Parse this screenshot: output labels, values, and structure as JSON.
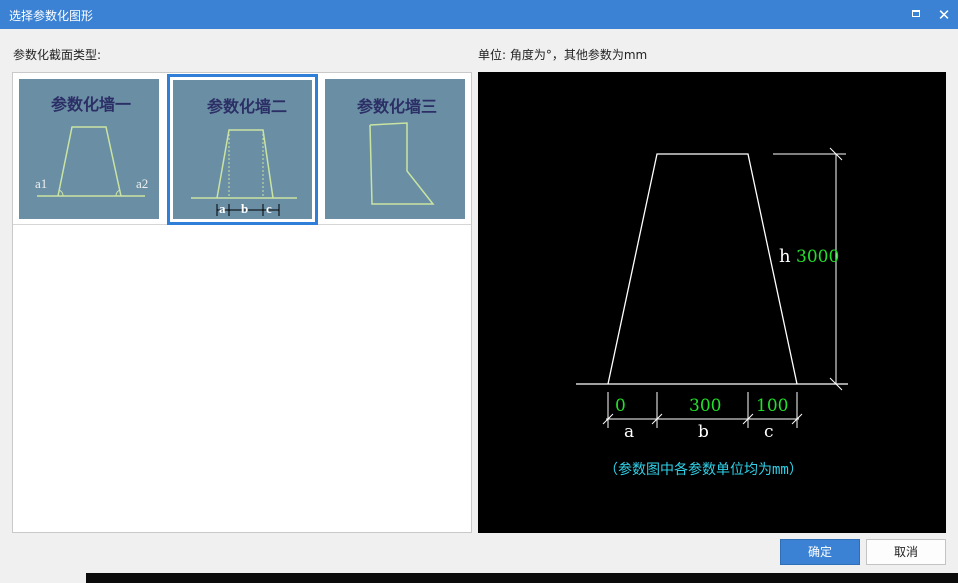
{
  "window": {
    "title": "选择参数化图形",
    "maximize_icon": "maximize-icon",
    "close_icon": "close-icon",
    "close_glyph": "✕",
    "accent_color": "#3b82d4"
  },
  "left_panel": {
    "label": "参数化截面类型:",
    "thumbnails": [
      {
        "title": "参数化墙一",
        "labels": [
          "a1",
          "a2"
        ],
        "selected": false
      },
      {
        "title": "参数化墙二",
        "labels": [
          "a",
          "b",
          "c"
        ],
        "selected": true
      },
      {
        "title": "参数化墙三",
        "labels": [],
        "selected": false
      }
    ]
  },
  "right_panel": {
    "label": "单位:  角度为°，其他参数为mm",
    "preview": {
      "height_label": "h",
      "height_value": "3000",
      "param_values": [
        "0",
        "300",
        "100"
      ],
      "param_names": [
        "a",
        "b",
        "c"
      ],
      "note": "（参数图中各参数单位均为mm）",
      "value_color": "#22e02a",
      "note_color": "#2fd0e8"
    }
  },
  "buttons": {
    "ok_label": "确定",
    "cancel_label": "取消"
  }
}
